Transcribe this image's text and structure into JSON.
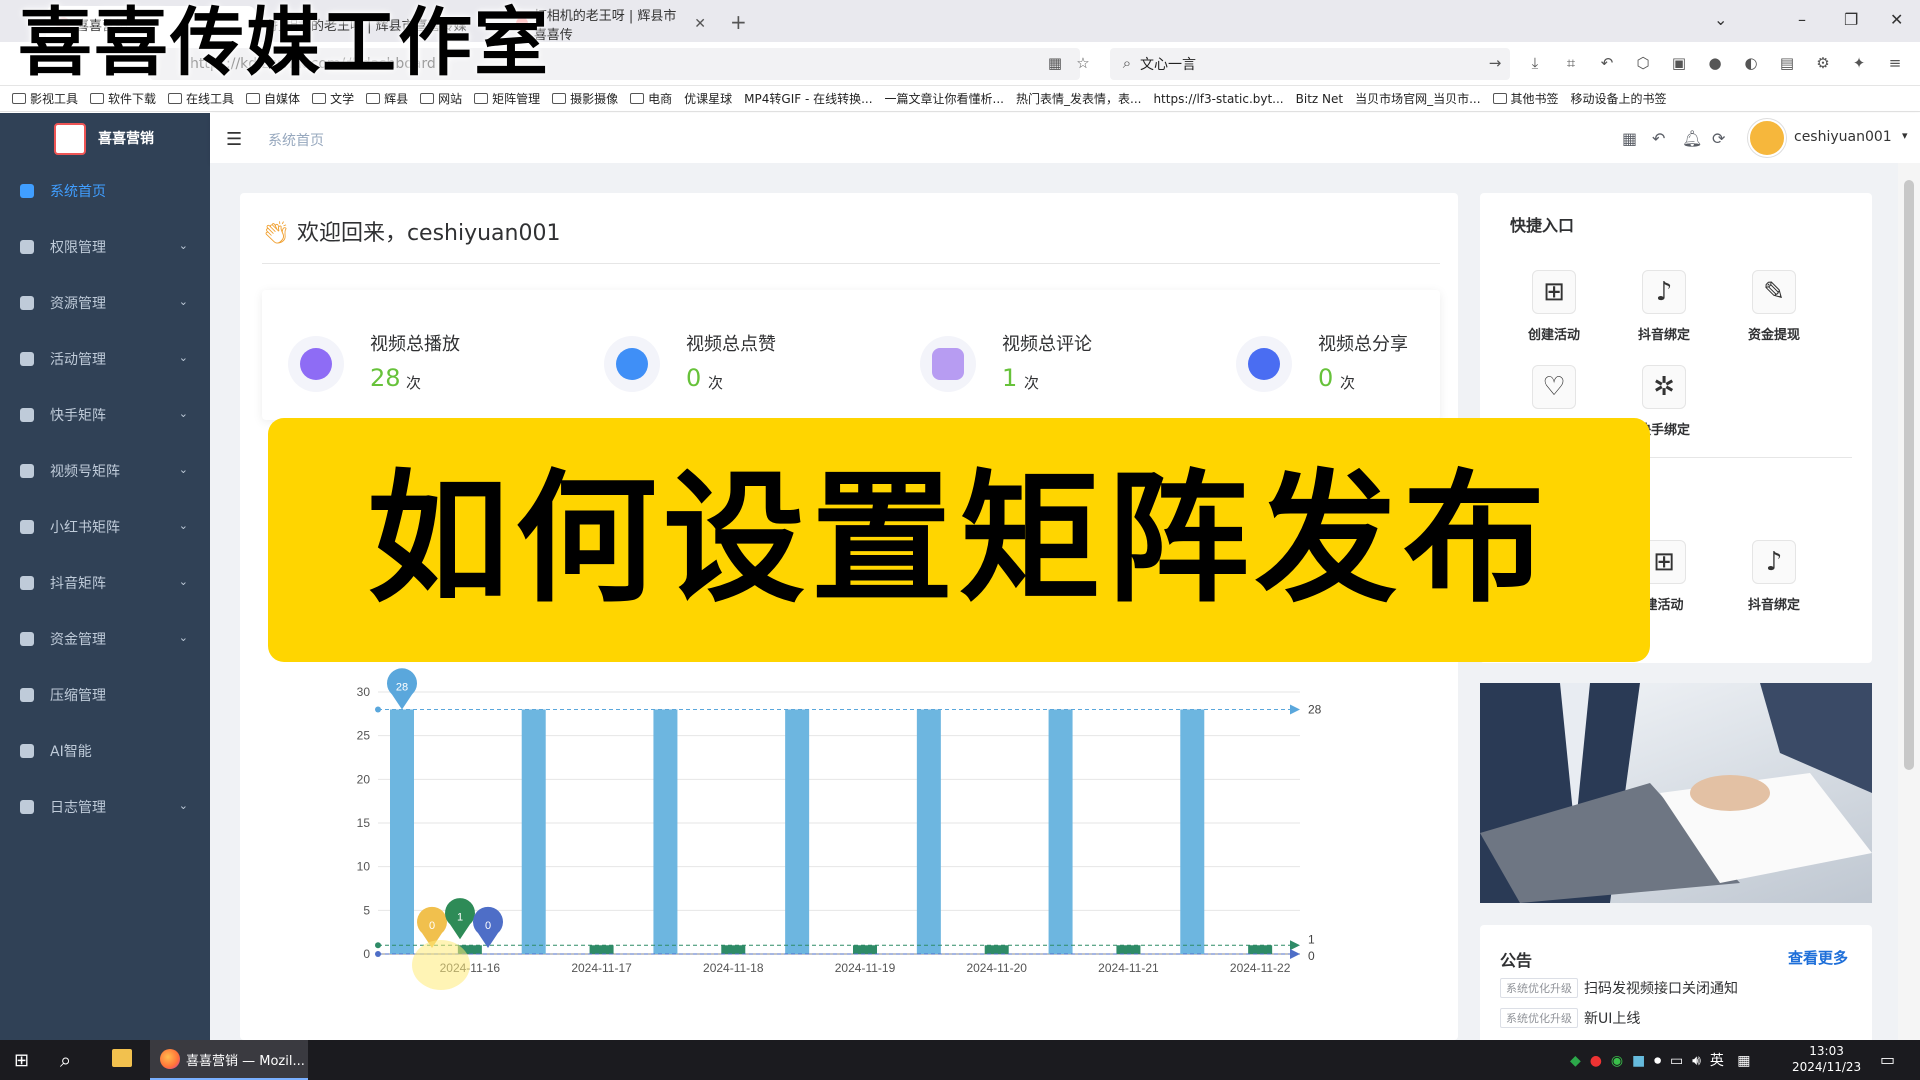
{
  "browser": {
    "tabs": [
      {
        "title": "喜喜营销"
      },
      {
        "title": "打相机的老王呀 | 辉县市喜喜传媒"
      },
      {
        "title": "打相机的老王呀 | 辉县市喜喜传"
      }
    ],
    "url": "https://kd.zwvltk.com/#/dashboard",
    "search_value": "文心一言",
    "bookmarks": [
      "影视工具",
      "软件下载",
      "在线工具",
      "自媒体",
      "文学",
      "辉县",
      "网站",
      "矩阵管理",
      "摄影摄像",
      "电商",
      "优课星球",
      "MP4转GIF - 在线转换...",
      "一篇文章让你看懂析...",
      "热门表情_发表情，表...",
      "https://lf3-static.byt...",
      "Bitz Net",
      "当贝市场官网_当贝市...",
      "其他书签",
      "移动设备上的书签"
    ]
  },
  "overlay": {
    "studio_title": "喜喜传媒工作室",
    "banner_text": "如何设置矩阵发布"
  },
  "sidebar": {
    "brand_name": "喜喜营销",
    "items": [
      {
        "label": "系统首页",
        "active": true
      },
      {
        "label": "权限管理"
      },
      {
        "label": "资源管理"
      },
      {
        "label": "活动管理"
      },
      {
        "label": "快手矩阵"
      },
      {
        "label": "视频号矩阵"
      },
      {
        "label": "小红书矩阵"
      },
      {
        "label": "抖音矩阵"
      },
      {
        "label": "资金管理"
      },
      {
        "label": "压缩管理"
      },
      {
        "label": "AI智能"
      },
      {
        "label": "日志管理"
      }
    ]
  },
  "header": {
    "breadcrumb": "系统首页",
    "username": "ceshiyuan001"
  },
  "welcome": {
    "text": "欢迎回来，ceshiyuan001"
  },
  "stats": [
    {
      "title": "视频总播放",
      "value": "28",
      "unit": "次",
      "color": "#8e6cf5"
    },
    {
      "title": "视频总点赞",
      "value": "0",
      "unit": "次",
      "color": "#3f8ff7"
    },
    {
      "title": "视频总评论",
      "value": "1",
      "unit": "次",
      "color": "#b79cf2"
    },
    {
      "title": "视频总分享",
      "value": "0",
      "unit": "次",
      "color": "#4a6df2"
    }
  ],
  "quick": {
    "title": "快捷入口",
    "items": [
      "创建活动",
      "抖音绑定",
      "资金提现",
      "快手绑定"
    ],
    "items_lower": [
      "建活动",
      "抖音绑定"
    ]
  },
  "notice": {
    "title": "公告",
    "more": "查看更多",
    "rows": [
      {
        "tag": "系统优化升级",
        "text": "扫码发视频接口关闭通知"
      },
      {
        "tag": "系统优化升级",
        "text": "新UI上线"
      }
    ]
  },
  "taskbar": {
    "app_label": "喜喜营销 — Mozil...",
    "time": "13:03",
    "date": "2024/11/23",
    "ime": "英"
  },
  "chart_data": {
    "type": "bar",
    "categories": [
      "2024-11-16",
      "2024-11-17",
      "2024-11-18",
      "2024-11-19",
      "2024-11-20",
      "2024-11-21",
      "2024-11-22"
    ],
    "ylim": [
      0,
      30
    ],
    "yticks": [
      0,
      5,
      10,
      15,
      20,
      25,
      30
    ],
    "series": [
      {
        "values": [
          28,
          28,
          28,
          28,
          28,
          28,
          28
        ],
        "color": "#6db6e0"
      },
      {
        "values": [
          1,
          1,
          1,
          1,
          1,
          1,
          1
        ],
        "color": "#2e8b67"
      }
    ],
    "markers": [
      {
        "label": "28",
        "color": "#5aa7dc"
      },
      {
        "label": "0",
        "color": "#f1c04d"
      },
      {
        "label": "1",
        "color": "#2e8b57"
      },
      {
        "label": "0",
        "color": "#4e6ec7"
      }
    ],
    "markline_labels": [
      "28",
      "1",
      "0"
    ]
  }
}
